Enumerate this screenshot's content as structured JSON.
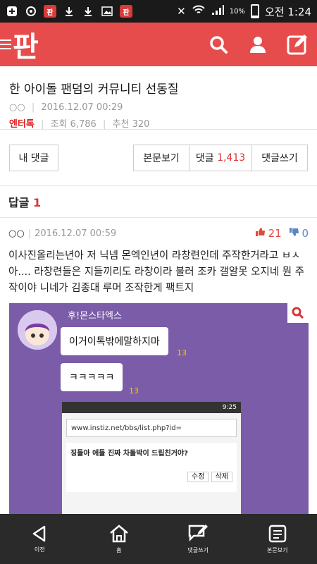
{
  "status": {
    "battery": "10%",
    "time": "오전 1:24"
  },
  "header": {
    "logo": "판"
  },
  "article": {
    "title": "한 아이돌 팬덤의 커뮤니티 선동질",
    "author": "○○",
    "date": "2016.12.07 00:29",
    "category": "엔터톡",
    "views": "조회 6,786",
    "recommends": "추천 320"
  },
  "buttons": {
    "my_comments": "내 댓글",
    "view_body": "본문보기",
    "comments_label": "댓글",
    "comments_count": "1,413",
    "write_comment": "댓글쓰기"
  },
  "reply_section": {
    "label": "답글",
    "count": "1"
  },
  "reply": {
    "author": "○○",
    "date": "2016.12.07 00:59",
    "likes": "21",
    "dislikes": "0",
    "text": "이사진올리는년아 저 닉넴 몬엑인년이 라창련인데 주작한거라고 ㅂㅅ아.... 라창련들은 지들끼리도 라창이라 불러 조카 갤알못 오지네 뭔 주작이야 니네가 김종대 루머 조작한게 팩트지"
  },
  "image": {
    "chat_name": "후!몬스타엑스",
    "bubble1": "이거이톡밖에말하지마",
    "bubble2": "ㅋㅋㅋㅋㅋ",
    "unread": "13",
    "phone_time": "9:25",
    "url": "www.instiz.net/bbs/list.php?id=",
    "post_title": "징들아 애들 진짜 차돌박이 드립친거야?",
    "edit": "수정",
    "delete": "삭제"
  },
  "nav": {
    "back": "이전",
    "home": "홈",
    "write": "댓글쓰기",
    "body": "본문보기"
  }
}
